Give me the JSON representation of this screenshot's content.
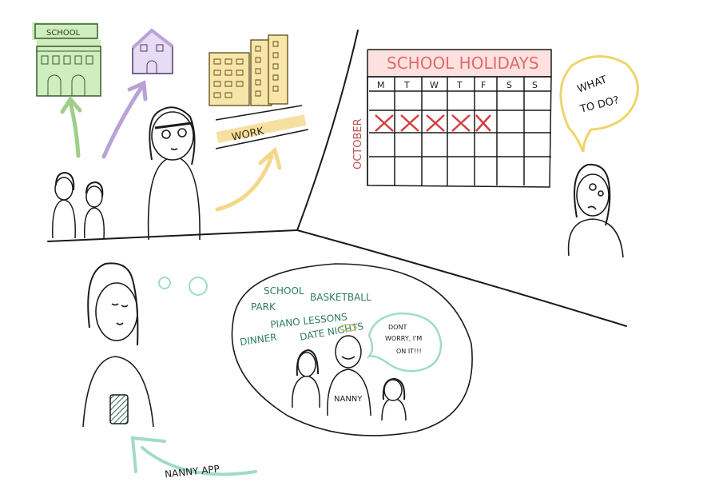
{
  "panel1": {
    "school_sign": "SCHOOL",
    "work_label": "WORK",
    "colors": {
      "school": "#8fcf7e",
      "house": "#b9a3d6",
      "work": "#f4d88a",
      "ink": "#1a1a1a"
    }
  },
  "panel2": {
    "calendar_title": "SCHOOL HOLIDAYS",
    "month_label": "OCTOBER",
    "weekdays": [
      "M",
      "T",
      "W",
      "T",
      "F",
      "S",
      "S"
    ],
    "crossed_days": 5,
    "thought": [
      "WHAT",
      "TO DO?"
    ],
    "colors": {
      "title": "#e06a6a",
      "cross": "#d04040",
      "month": "#c0504d",
      "thought": "#f2d36b"
    }
  },
  "panel3": {
    "dream_words": [
      "SCHOOL",
      "PARK",
      "BASKETBALL",
      "PIANO LESSONS",
      "DINNER",
      "DATE NIGHTS"
    ],
    "speech": [
      "DONT",
      "WORRY, I'M",
      "ON IT!!!"
    ],
    "nanny_shirt": "NANNY",
    "app_label": "NANNY APP",
    "colors": {
      "dream": "#2e7d5b",
      "bubble": "#9fdcc8",
      "phone": "#2f6b4a"
    }
  }
}
